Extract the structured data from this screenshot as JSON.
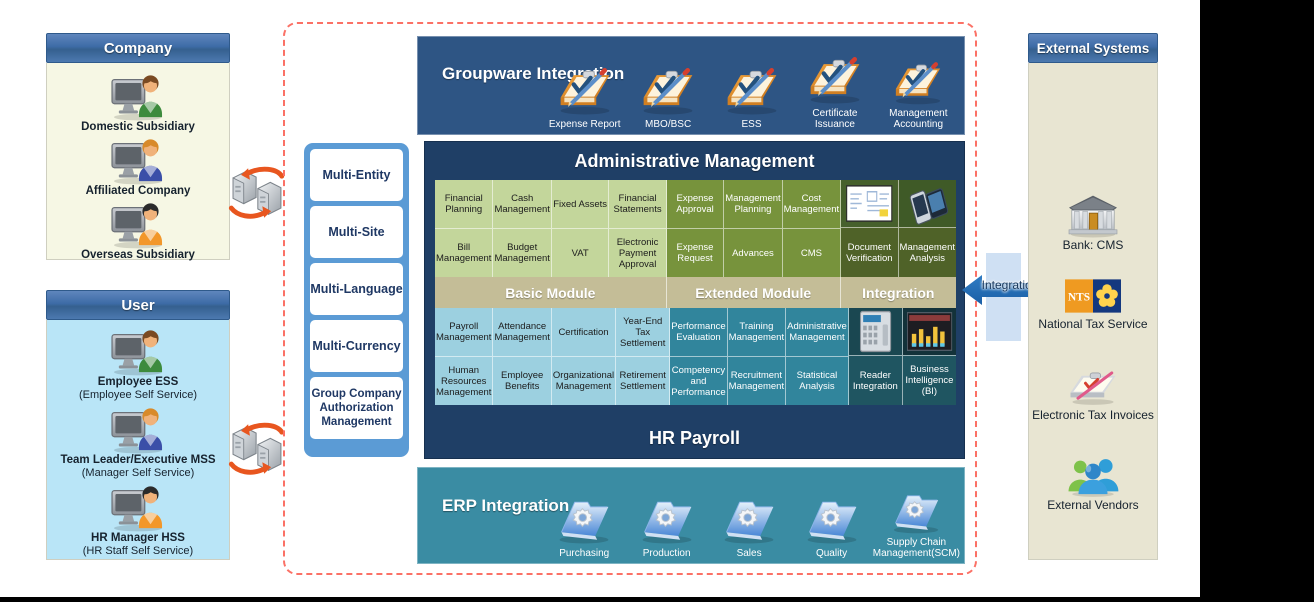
{
  "company_panel": {
    "title": "Company",
    "items": [
      {
        "label": "Domestic Subsidiary",
        "icon": "user-computer-green-icon"
      },
      {
        "label": "Affiliated Company",
        "icon": "user-computer-blue-icon"
      },
      {
        "label": "Overseas Subsidiary",
        "icon": "user-computer-orange-icon"
      }
    ]
  },
  "user_panel": {
    "title": "User",
    "items": [
      {
        "label": "Employee ESS",
        "sub": "(Employee Self Service)",
        "icon": "user-computer-green-icon"
      },
      {
        "label": "Team Leader/Executive MSS",
        "sub": "(Manager Self Service)",
        "icon": "user-computer-blue-icon"
      },
      {
        "label": "HR Manager HSS",
        "sub": "(HR Staff Self Service)",
        "icon": "user-computer-orange-icon"
      }
    ]
  },
  "sync_icons": {
    "top": "server-sync-icon",
    "bottom": "server-sync-icon"
  },
  "features": [
    {
      "label": "Multi-Entity"
    },
    {
      "label": "Multi-Site"
    },
    {
      "label": "Multi-Language"
    },
    {
      "label": "Multi-Currency"
    },
    {
      "label": "Group Company Authorization Management"
    }
  ],
  "groupware": {
    "title": "Groupware Integration",
    "items": [
      {
        "label": "Expense Report",
        "icon": "clipboard-check-icon"
      },
      {
        "label": "MBO/BSC",
        "icon": "clipboard-check-icon"
      },
      {
        "label": "ESS",
        "icon": "clipboard-check-icon"
      },
      {
        "label": "Certificate Issuance",
        "icon": "clipboard-check-icon"
      },
      {
        "label": "Management Accounting",
        "icon": "clipboard-check-icon"
      }
    ]
  },
  "erp": {
    "title": "ERP Integration",
    "items": [
      {
        "label": "Purchasing",
        "icon": "gear-folder-icon"
      },
      {
        "label": "Production",
        "icon": "gear-folder-icon"
      },
      {
        "label": "Sales",
        "icon": "gear-folder-icon"
      },
      {
        "label": "Quality",
        "icon": "gear-folder-icon"
      },
      {
        "label": "Supply Chain Management(SCM)",
        "icon": "gear-folder-icon"
      }
    ]
  },
  "board": {
    "admin_title": "Administrative Management",
    "hr_title": "HR Payroll",
    "module_bands": [
      "Basic Module",
      "Extended Module",
      "Integration"
    ],
    "admin_grid": {
      "basic": [
        [
          "Financial Planning",
          "Bill Management"
        ],
        [
          "Cash Management",
          "Budget Management"
        ],
        [
          "Fixed Assets",
          "VAT"
        ],
        [
          "Financial Statements",
          "Electronic Payment Approval"
        ]
      ],
      "extended": [
        [
          "Expense Approval",
          "Expense Request"
        ],
        [
          "Management Planning",
          "Advances"
        ],
        [
          "Cost Management",
          "CMS"
        ]
      ],
      "integration": [
        [
          "",
          "Document Verification"
        ],
        [
          "",
          "Management Analysis"
        ]
      ]
    },
    "hr_grid": {
      "basic": [
        [
          "Payroll Management",
          "Human Resources Management"
        ],
        [
          "Attendance Management",
          "Employee Benefits"
        ],
        [
          "Certification",
          "Organizational Management"
        ],
        [
          "Year-End Tax Settlement",
          "Retirement Settlement"
        ]
      ],
      "extended": [
        [
          "Performance Evaluation",
          "Competency and Performance"
        ],
        [
          "Training Management",
          "Recruitment Management"
        ],
        [
          "Administrative Management",
          "Statistical Analysis"
        ]
      ],
      "integration": [
        [
          "",
          "Reader Integration"
        ],
        [
          "",
          "Business Intelligence (BI)"
        ]
      ]
    }
  },
  "integration_arrow": {
    "label": "Integration",
    "icon": "double-arrow-icon"
  },
  "external_panel": {
    "title": "External Systems",
    "items": [
      {
        "label": "Bank: CMS",
        "icon": "bank-building-icon"
      },
      {
        "label": "National Tax Service",
        "icon": "nts-logo-icon"
      },
      {
        "label": "Electronic Tax Invoices",
        "icon": "invoice-clipboard-icon"
      },
      {
        "label": "External Vendors",
        "icon": "people-group-icon"
      }
    ]
  },
  "colors": {
    "header_blue": "#3d6ba6",
    "cream": "#f6f7e4",
    "sky": "#b9e5f7",
    "beige": "#e8e5d2",
    "board_navy": "#1f3f66",
    "basic_green": "#c3d69b",
    "extended_green": "#77933c",
    "integration_green": "#4f6228",
    "basic_cyan": "#9cd0e0",
    "extended_cyan": "#31859c",
    "integration_cyan": "#1f5561",
    "band_khaki": "#c4bd97",
    "dashed_red": "#fb7166",
    "feature_blue": "#5b9bd5",
    "groupware_navy": "#2e5584",
    "erp_teal": "#3a8ca3"
  }
}
